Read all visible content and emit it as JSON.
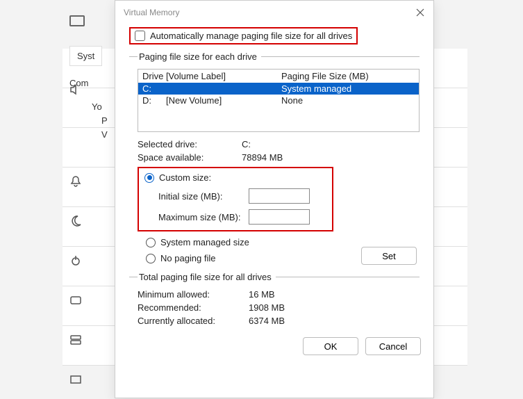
{
  "bg": {
    "syst": "Syst",
    "com": "Com",
    "y": "Yo",
    "p": "P",
    "v": "V"
  },
  "dialog": {
    "title": "Virtual Memory",
    "auto_manage": "Automatically manage paging file size for all drives",
    "group1_legend": "Paging file size for each drive",
    "table": {
      "col_drive": "Drive  [Volume Label]",
      "col_size": "Paging File Size (MB)",
      "rows": [
        {
          "drv": "C:",
          "vol": "",
          "size": "System managed",
          "selected": true
        },
        {
          "drv": "D:",
          "vol": "[New Volume]",
          "size": "None",
          "selected": false
        }
      ]
    },
    "selected_drive_label": "Selected drive:",
    "selected_drive_value": "C:",
    "space_available_label": "Space available:",
    "space_available_value": "78894 MB",
    "custom_size": "Custom size:",
    "initial_size": "Initial size (MB):",
    "maximum_size": "Maximum size (MB):",
    "system_managed": "System managed size",
    "no_paging": "No paging file",
    "set": "Set",
    "group2_legend": "Total paging file size for all drives",
    "min_allowed_label": "Minimum allowed:",
    "min_allowed_value": "16 MB",
    "recommended_label": "Recommended:",
    "recommended_value": "1908 MB",
    "currently_label": "Currently allocated:",
    "currently_value": "6374 MB",
    "ok": "OK",
    "cancel": "Cancel"
  }
}
